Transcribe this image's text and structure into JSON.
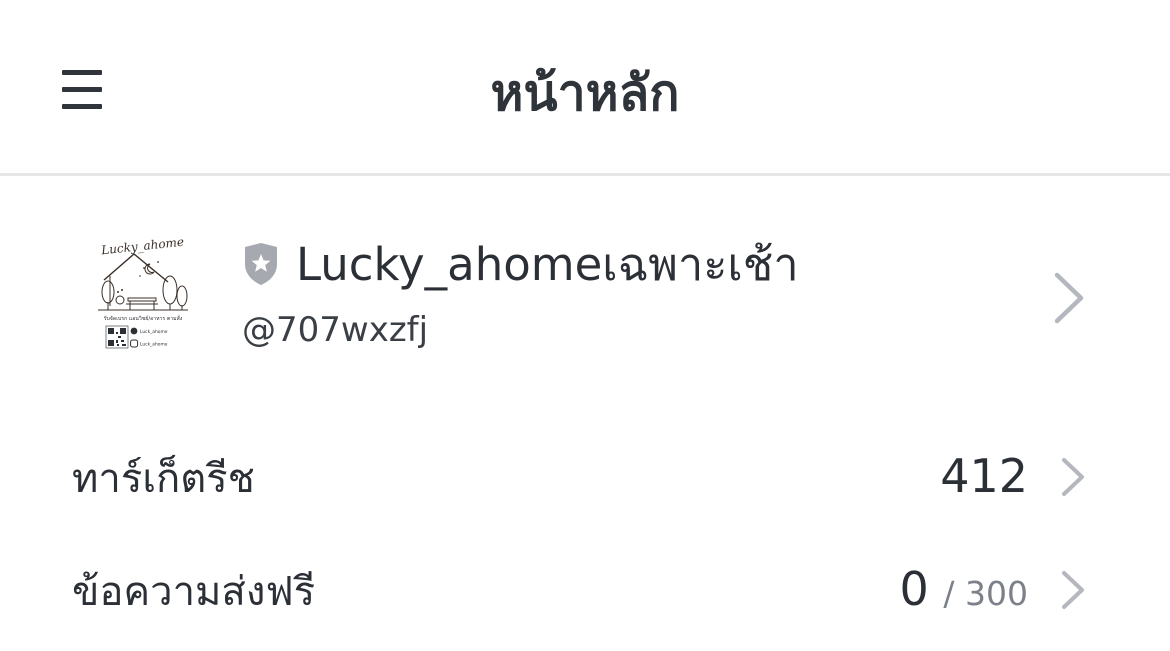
{
  "header": {
    "title": "หน้าหลัก",
    "menu_icon": "hamburger-menu-icon"
  },
  "account": {
    "name": "Lucky_ahomeเฉพาะเช้า",
    "id": "@707wxzfj",
    "badge_icon": "shield-star-icon",
    "logo": {
      "title": "Lucky_ahome",
      "tagline": "รับจัดเบรก แอนวิชย์/อาหาร ตามสั่ง",
      "social_handle_1": "Luck_ahome",
      "social_handle_2": "Luck_ahome"
    }
  },
  "stats": {
    "targeted_reach": {
      "label": "ทาร์เก็ตรีช",
      "value": "412"
    },
    "free_messages": {
      "label": "ข้อความส่งฟรี",
      "used": "0",
      "separator": "/",
      "total": "300"
    }
  },
  "colors": {
    "text": "#2b2f36",
    "muted": "#7c8089",
    "chevron": "#b4b7be",
    "divider": "#e6e6e8",
    "shield": "#a6a9b0"
  }
}
